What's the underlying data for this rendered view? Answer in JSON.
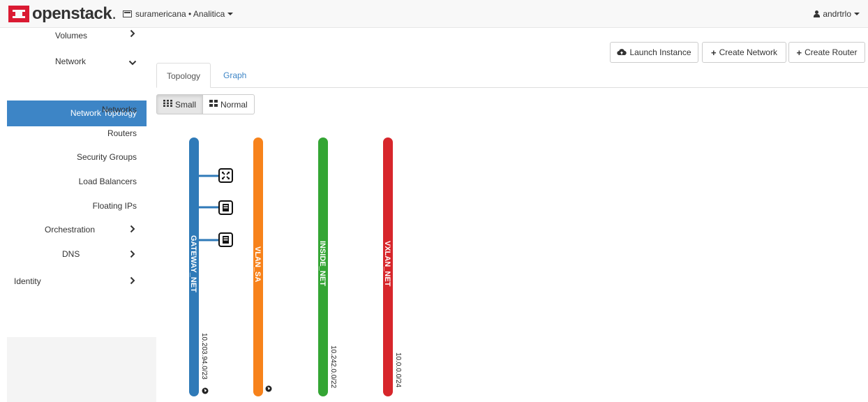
{
  "navbar": {
    "brand": "openstack",
    "project": "suramericana • Analitica",
    "user": "andrtrlo"
  },
  "sidebar": {
    "items": [
      {
        "label": "Volumes"
      },
      {
        "label": "Network"
      },
      {
        "label": "Network Topology"
      },
      {
        "label": "Networks"
      },
      {
        "label": "Routers"
      },
      {
        "label": "Security Groups"
      },
      {
        "label": "Load Balancers"
      },
      {
        "label": "Floating IPs"
      },
      {
        "label": "Orchestration"
      },
      {
        "label": "DNS"
      },
      {
        "label": "Identity"
      }
    ]
  },
  "actions": {
    "launch_instance": "Launch Instance",
    "create_network": "Create Network",
    "create_router": "Create Router"
  },
  "tabs": {
    "topology": "Topology",
    "graph": "Graph"
  },
  "view_size": {
    "small": "Small",
    "normal": "Normal",
    "selected": "Small"
  },
  "colors": {
    "accent": "#3d85c6",
    "logo": "#da1a32",
    "gateway_net": "#2f7ab8",
    "vlan_sa": "#f7821b",
    "inside_net": "#34a534",
    "vxlan_net": "#d7262b"
  },
  "networks": [
    {
      "name": "GATEWAY_NET",
      "cidr": "10.203.94.0/23",
      "external": true
    },
    {
      "name": "VLAN_SA",
      "cidr": "",
      "external": true
    },
    {
      "name": "INSIDE_NET",
      "cidr": "10.242.0.0/22",
      "external": false
    },
    {
      "name": "VXLAN_NET",
      "cidr": "10.0.0.0/24",
      "external": false
    }
  ],
  "devices": [
    {
      "type": "router",
      "icon": "router-icon"
    },
    {
      "type": "instance",
      "icon": "instance-icon"
    },
    {
      "type": "instance",
      "icon": "instance-icon"
    }
  ]
}
